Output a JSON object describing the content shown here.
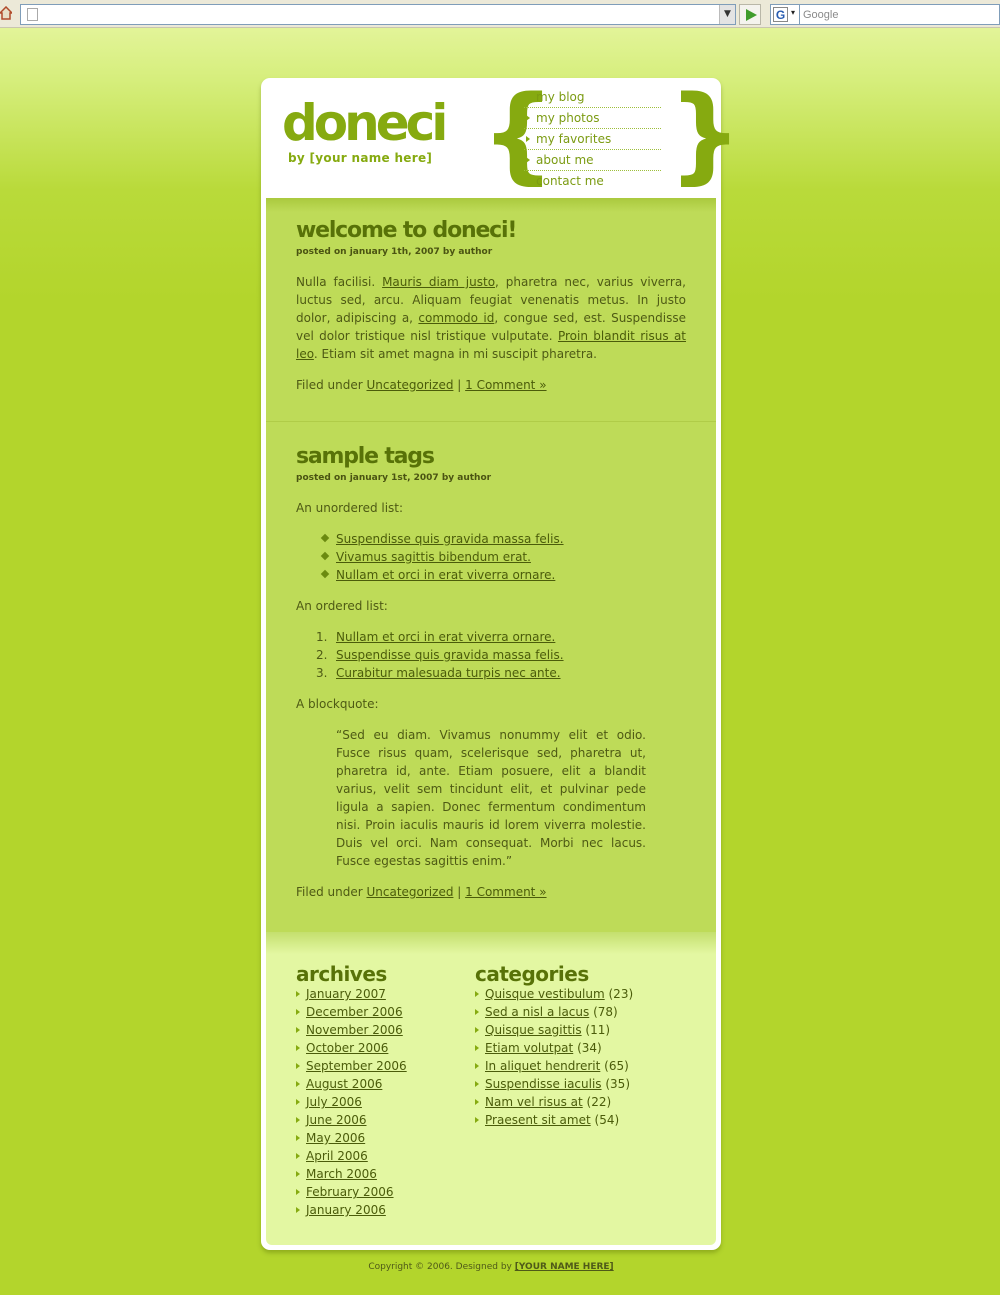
{
  "browser": {
    "search_placeholder": "Google",
    "search_engine_glyph": "G"
  },
  "site": {
    "logo": "doneci",
    "tagline": "by [your name here]",
    "brace_left": "{",
    "brace_right": "}",
    "accent_color": "#86aa10",
    "nav": [
      "my blog",
      "my photos",
      "my favorites",
      "about me",
      "contact me"
    ]
  },
  "posts": [
    {
      "title": "welcome to doneci!",
      "meta": "posted on january 1th, 2007 by author",
      "body": {
        "t1": "Nulla facilisi. ",
        "l1": "Mauris diam justo",
        "t2": ", pharetra nec, varius viverra, luctus sed, arcu. Aliquam feugiat venenatis metus. In justo dolor, adipiscing a, ",
        "l2": "commodo id",
        "t3": ", congue sed, est. Suspendisse vel dolor tristique nisl tristique vulputate. ",
        "l3": "Proin blandit risus at leo",
        "t4": ". Etiam sit amet magna in mi suscipit pharetra."
      },
      "filed_label": "Filed under",
      "category": "Uncategorized",
      "divider": "|",
      "comments": "1 Comment »"
    },
    {
      "title": "sample tags",
      "meta": "posted on january 1st, 2007 by author",
      "ul_label": "An unordered list:",
      "ul": [
        "Suspendisse quis gravida massa felis.",
        "Vivamus sagittis bibendum erat.",
        "Nullam et orci in erat viverra ornare."
      ],
      "ol_label": "An ordered list:",
      "ol": [
        "Nullam et orci in erat viverra ornare.",
        "Suspendisse quis gravida massa felis.",
        "Curabitur malesuada turpis nec ante."
      ],
      "ol_nums": [
        "1.",
        "2.",
        "3."
      ],
      "bq_label": "A blockquote:",
      "blockquote": "“Sed eu diam. Vivamus nonummy elit et odio. Fusce risus quam, scelerisque sed, pharetra ut, pharetra id, ante. Etiam posuere, elit a blandit varius, velit sem tincidunt elit, et pulvinar pede ligula a sapien. Donec fermentum condimentum nisi. Proin iaculis mauris id lorem viverra molestie. Duis vel orci. Nam consequat. Morbi nec lacus. Fusce egestas sagittis enim.”",
      "filed_label": "Filed under",
      "category": "Uncategorized",
      "divider": "|",
      "comments": "1 Comment »"
    }
  ],
  "archives": {
    "title": "archives",
    "items": [
      "January 2007",
      "December 2006",
      "November 2006",
      "October 2006",
      "September 2006",
      "August 2006",
      "July 2006",
      "June 2006",
      "May 2006",
      "April 2006",
      "March 2006",
      "February 2006",
      "January 2006"
    ]
  },
  "categories": {
    "title": "categories",
    "items": [
      {
        "name": "Quisque vestibulum",
        "count": " (23)"
      },
      {
        "name": "Sed a nisl a lacus",
        "count": " (78)"
      },
      {
        "name": "Quisque sagittis",
        "count": " (11)"
      },
      {
        "name": "Etiam volutpat",
        "count": " (34)"
      },
      {
        "name": "In aliquet hendrerit",
        "count": " (65)"
      },
      {
        "name": "Suspendisse iaculis",
        "count": " (35)"
      },
      {
        "name": "Nam vel risus at",
        "count": " (22)"
      },
      {
        "name": "Praesent sit amet",
        "count": " (54)"
      }
    ]
  },
  "footer": {
    "copyright": "Copyright © 2006. Designed by ",
    "designer": "[YOUR NAME HERE]"
  }
}
